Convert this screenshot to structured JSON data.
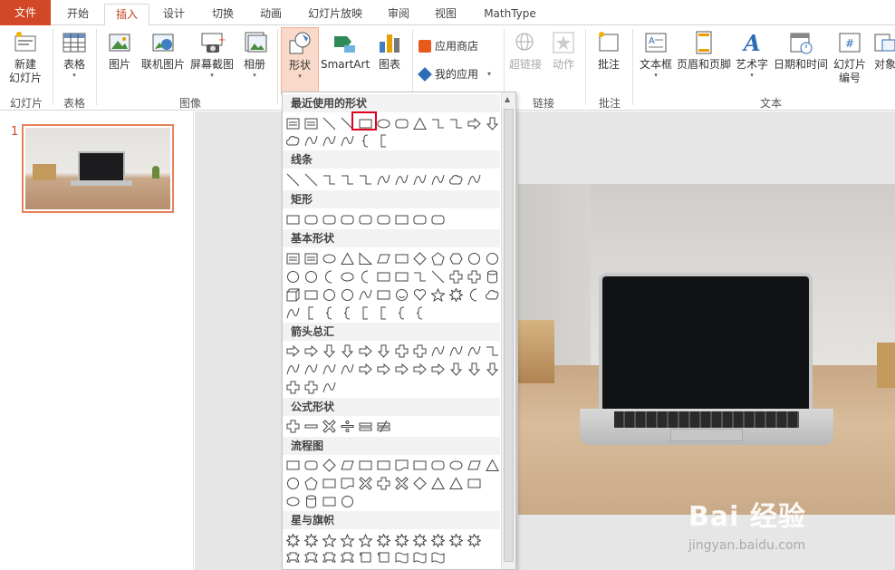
{
  "tabs": [
    "文件",
    "开始",
    "插入",
    "设计",
    "切换",
    "动画",
    "幻灯片放映",
    "审阅",
    "视图",
    "MathType"
  ],
  "ribbon": {
    "new_slide": "新建\n幻灯片",
    "table": "表格",
    "picture": "图片",
    "online_picture": "联机图片",
    "screenshot": "屏幕截图",
    "album": "相册",
    "shapes": "形状",
    "smartart": "SmartArt",
    "chart": "图表",
    "app_store": "应用商店",
    "my_apps": "我的应用",
    "hyperlink": "超链接",
    "action": "动作",
    "comment": "批注",
    "textbox": "文本框",
    "header_footer": "页眉和页脚",
    "wordart": "艺术字",
    "date_time": "日期和时间",
    "slide_number": "幻灯片\n编号",
    "object": "对象",
    "groups": {
      "slides": "幻灯片",
      "tables": "表格",
      "images": "图像",
      "links": "链接",
      "comments": "批注",
      "text": "文本"
    }
  },
  "slide_pane": {
    "slide_number": "1"
  },
  "shapes_dropdown": {
    "categories": [
      "最近使用的形状",
      "线条",
      "矩形",
      "基本形状",
      "箭头总汇",
      "公式形状",
      "流程图",
      "星与旗帜"
    ]
  },
  "watermark": {
    "main": "Bai 经验",
    "url": "jingyan.baidu.com"
  },
  "colors": {
    "file_tab": "#d24726",
    "active_tab_text": "#c43e1c",
    "selection_outline": "#e0001b"
  }
}
